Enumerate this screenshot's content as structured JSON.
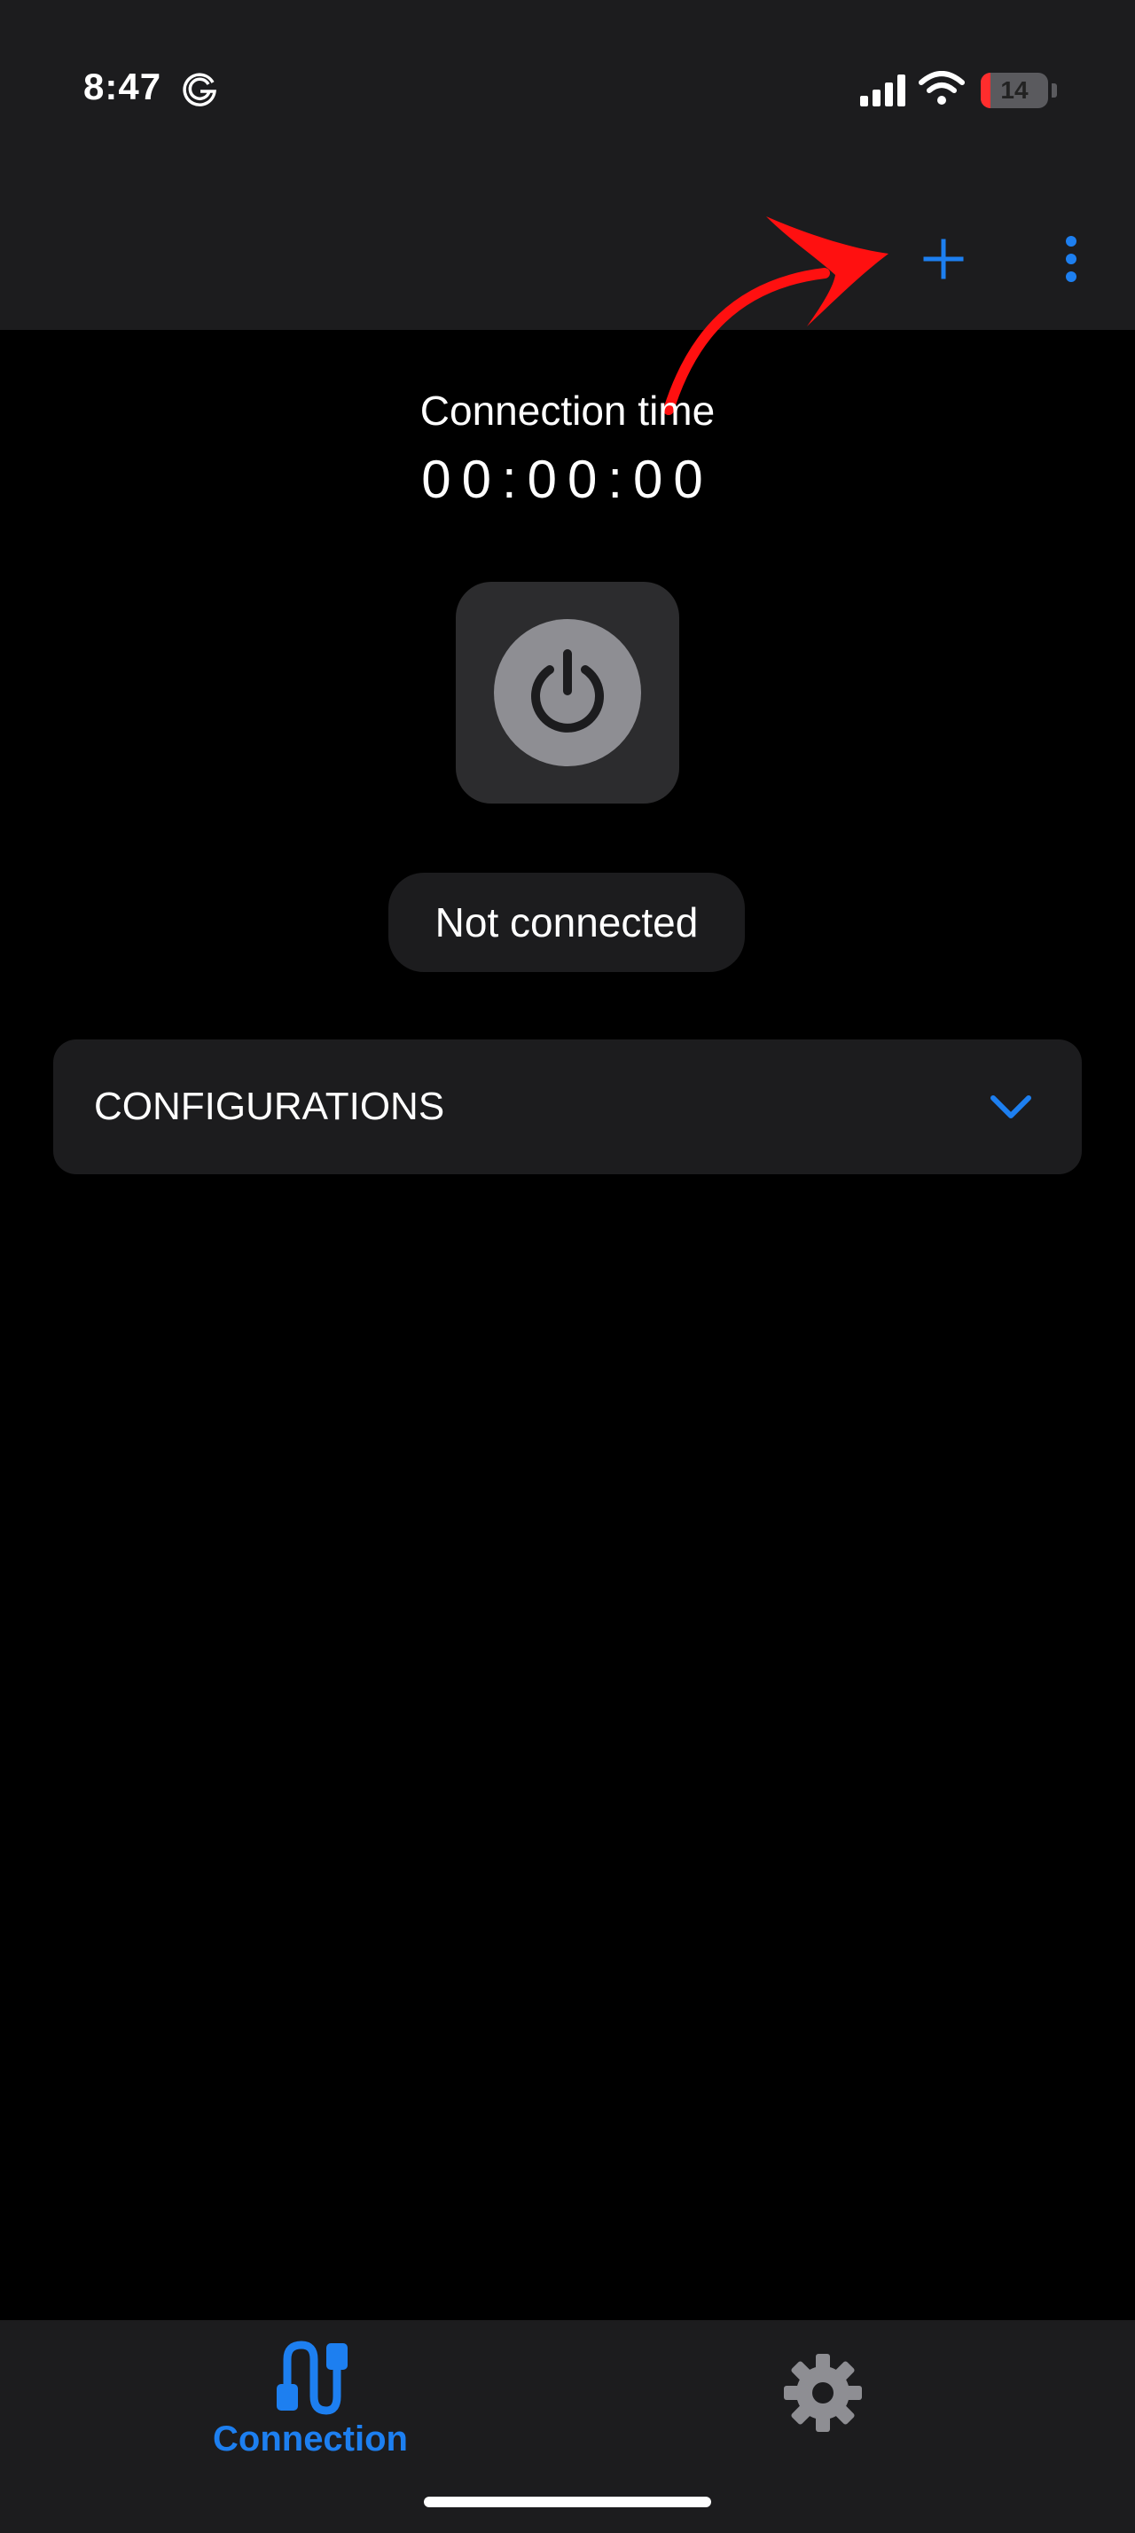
{
  "status_bar": {
    "time": "8:47",
    "battery_level": "14",
    "battery_fraction": 0.14
  },
  "toolbar": {
    "add_icon": "plus-icon",
    "menu_icon": "more-vertical-icon"
  },
  "main": {
    "connection_time_label": "Connection time",
    "connection_time_value": "00:00:00",
    "power_icon": "power-icon",
    "status_text": "Not connected",
    "configurations_title": "CONFIGURATIONS",
    "configurations_expanded": false
  },
  "bottom_nav": {
    "connection_label": "Connection",
    "connection_icon": "cable-icon",
    "settings_icon": "gear-icon",
    "active_tab": "connection"
  },
  "colors": {
    "accent": "#1d7ff0",
    "annotation": "#ff1010",
    "surface": "#1c1c1e",
    "background": "#000000",
    "power_button": "#8e8e93"
  }
}
